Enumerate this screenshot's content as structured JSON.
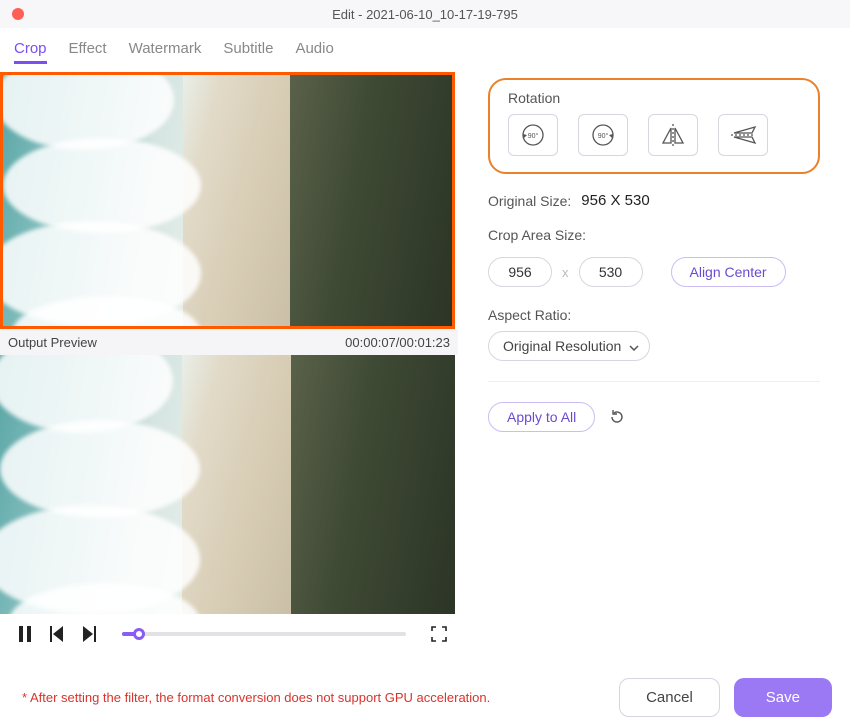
{
  "title": "Edit - 2021-06-10_10-17-19-795",
  "tabs": [
    "Crop",
    "Effect",
    "Watermark",
    "Subtitle",
    "Audio"
  ],
  "active_tab": "Crop",
  "preview": {
    "label": "Output Preview",
    "timecode": "00:00:07/00:01:23"
  },
  "panel": {
    "rotation_label": "Rotation",
    "original_size_label": "Original Size:",
    "original_size_value": "956 X 530",
    "crop_area_label": "Crop Area Size:",
    "crop_w": "956",
    "crop_h": "530",
    "crop_sep": "x",
    "align_center": "Align Center",
    "aspect_ratio_label": "Aspect Ratio:",
    "aspect_ratio_value": "Original Resolution",
    "apply_all": "Apply to All"
  },
  "footer": {
    "note": "* After setting the filter, the format conversion does not support GPU acceleration.",
    "cancel": "Cancel",
    "save": "Save"
  }
}
